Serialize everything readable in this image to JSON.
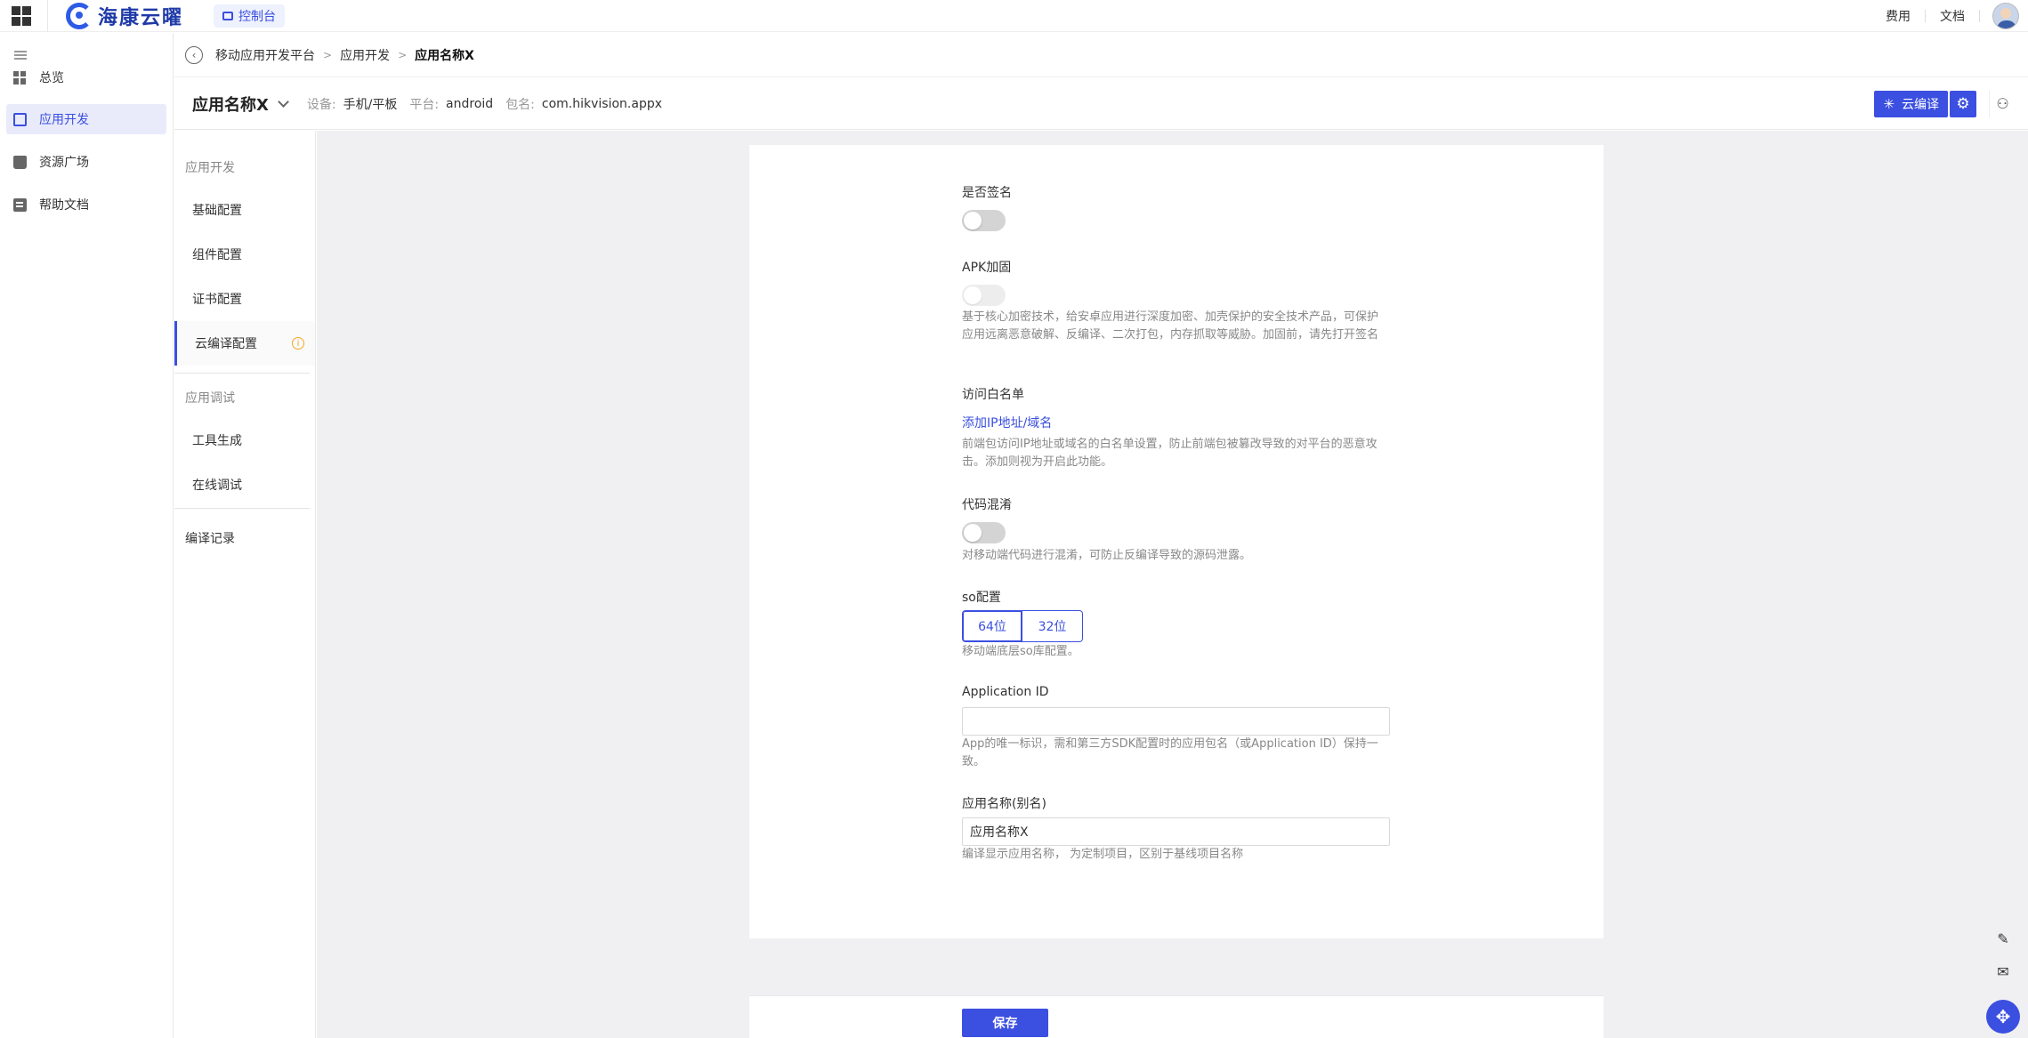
{
  "topbar": {
    "logo_text": "海康云曜",
    "console_label": "控制台",
    "links": [
      "费用",
      "文档"
    ]
  },
  "leftnav": {
    "items": [
      {
        "label": "总览",
        "icon": "grid-icon"
      },
      {
        "label": "应用开发",
        "icon": "code-icon",
        "active": true
      },
      {
        "label": "资源广场",
        "icon": "bag-icon"
      },
      {
        "label": "帮助文档",
        "icon": "doc-icon"
      }
    ]
  },
  "breadcrumb": [
    "移动应用开发平台",
    "应用开发",
    "应用名称X"
  ],
  "app_header": {
    "name": "应用名称X",
    "device_label": "设备:",
    "device_value": "手机/平板",
    "platform_label": "平台:",
    "platform_value": "android",
    "package_label": "包名:",
    "package_value": "com.hikvision.appx",
    "cloud_compile_label": "云编译"
  },
  "subnav": {
    "group1": "应用开发",
    "items1": [
      "基础配置",
      "组件配置",
      "证书配置",
      "云编译配置"
    ],
    "group2": "应用调试",
    "items2": [
      "工具生成",
      "在线调试"
    ],
    "record": "编译记录"
  },
  "form": {
    "sign": {
      "label": "是否签名",
      "on": false
    },
    "apk": {
      "label": "APK加固",
      "on": false,
      "disabled": true,
      "help": "基于核心加密技术，给安卓应用进行深度加密、加壳保护的安全技术产品，可保护应用远离恶意破解、反编译、二次打包，内存抓取等威胁。加固前，请先打开签名"
    },
    "whitelist": {
      "label": "访问白名单",
      "link": "添加IP地址/域名",
      "help": "前端包访问IP地址或域名的白名单设置，防止前端包被篡改导致的对平台的恶意攻击。添加则视为开启此功能。"
    },
    "obfuscate": {
      "label": "代码混淆",
      "on": false,
      "help": "对移动端代码进行混淆，可防止反编译导致的源码泄露。"
    },
    "so": {
      "label": "so配置",
      "options": [
        "64位",
        "32位"
      ],
      "help": "移动端底层so库配置。"
    },
    "application_id": {
      "label": "Application ID",
      "value": "",
      "help": "App的唯一标识，需和第三方SDK配置时的应用包名（或Application ID）保持一致。"
    },
    "alias": {
      "label": "应用名称(别名)",
      "value": "应用名称X",
      "help": "编译显示应用名称， 为定制项目，区别于基线项目名称"
    }
  },
  "save_label": "保存",
  "colors": {
    "accent": "#3b4fe0",
    "background": "#f0f0f2"
  }
}
